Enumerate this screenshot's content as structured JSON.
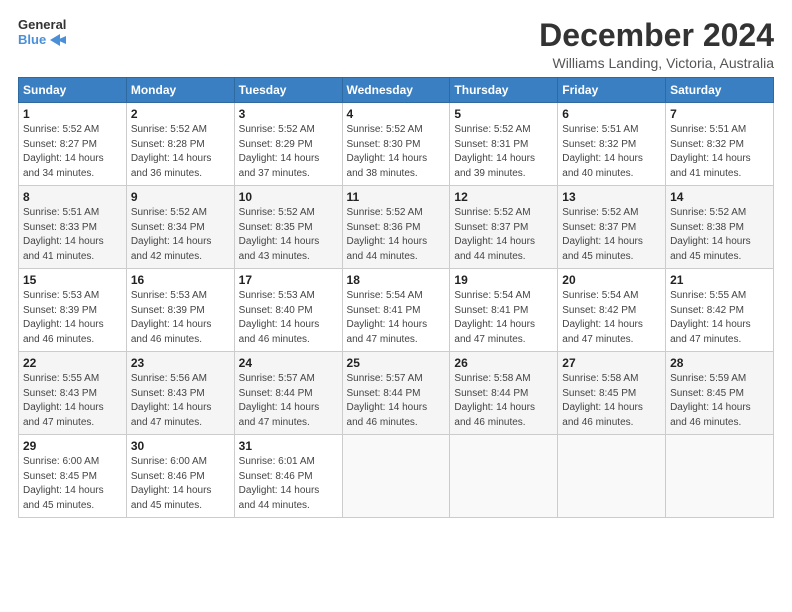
{
  "logo": {
    "general": "General",
    "blue": "Blue"
  },
  "title": "December 2024",
  "location": "Williams Landing, Victoria, Australia",
  "days_header": [
    "Sunday",
    "Monday",
    "Tuesday",
    "Wednesday",
    "Thursday",
    "Friday",
    "Saturday"
  ],
  "weeks": [
    [
      {
        "day": "1",
        "sunrise": "Sunrise: 5:52 AM",
        "sunset": "Sunset: 8:27 PM",
        "daylight": "Daylight: 14 hours and 34 minutes."
      },
      {
        "day": "2",
        "sunrise": "Sunrise: 5:52 AM",
        "sunset": "Sunset: 8:28 PM",
        "daylight": "Daylight: 14 hours and 36 minutes."
      },
      {
        "day": "3",
        "sunrise": "Sunrise: 5:52 AM",
        "sunset": "Sunset: 8:29 PM",
        "daylight": "Daylight: 14 hours and 37 minutes."
      },
      {
        "day": "4",
        "sunrise": "Sunrise: 5:52 AM",
        "sunset": "Sunset: 8:30 PM",
        "daylight": "Daylight: 14 hours and 38 minutes."
      },
      {
        "day": "5",
        "sunrise": "Sunrise: 5:52 AM",
        "sunset": "Sunset: 8:31 PM",
        "daylight": "Daylight: 14 hours and 39 minutes."
      },
      {
        "day": "6",
        "sunrise": "Sunrise: 5:51 AM",
        "sunset": "Sunset: 8:32 PM",
        "daylight": "Daylight: 14 hours and 40 minutes."
      },
      {
        "day": "7",
        "sunrise": "Sunrise: 5:51 AM",
        "sunset": "Sunset: 8:32 PM",
        "daylight": "Daylight: 14 hours and 41 minutes."
      }
    ],
    [
      {
        "day": "8",
        "sunrise": "Sunrise: 5:51 AM",
        "sunset": "Sunset: 8:33 PM",
        "daylight": "Daylight: 14 hours and 41 minutes."
      },
      {
        "day": "9",
        "sunrise": "Sunrise: 5:52 AM",
        "sunset": "Sunset: 8:34 PM",
        "daylight": "Daylight: 14 hours and 42 minutes."
      },
      {
        "day": "10",
        "sunrise": "Sunrise: 5:52 AM",
        "sunset": "Sunset: 8:35 PM",
        "daylight": "Daylight: 14 hours and 43 minutes."
      },
      {
        "day": "11",
        "sunrise": "Sunrise: 5:52 AM",
        "sunset": "Sunset: 8:36 PM",
        "daylight": "Daylight: 14 hours and 44 minutes."
      },
      {
        "day": "12",
        "sunrise": "Sunrise: 5:52 AM",
        "sunset": "Sunset: 8:37 PM",
        "daylight": "Daylight: 14 hours and 44 minutes."
      },
      {
        "day": "13",
        "sunrise": "Sunrise: 5:52 AM",
        "sunset": "Sunset: 8:37 PM",
        "daylight": "Daylight: 14 hours and 45 minutes."
      },
      {
        "day": "14",
        "sunrise": "Sunrise: 5:52 AM",
        "sunset": "Sunset: 8:38 PM",
        "daylight": "Daylight: 14 hours and 45 minutes."
      }
    ],
    [
      {
        "day": "15",
        "sunrise": "Sunrise: 5:53 AM",
        "sunset": "Sunset: 8:39 PM",
        "daylight": "Daylight: 14 hours and 46 minutes."
      },
      {
        "day": "16",
        "sunrise": "Sunrise: 5:53 AM",
        "sunset": "Sunset: 8:39 PM",
        "daylight": "Daylight: 14 hours and 46 minutes."
      },
      {
        "day": "17",
        "sunrise": "Sunrise: 5:53 AM",
        "sunset": "Sunset: 8:40 PM",
        "daylight": "Daylight: 14 hours and 46 minutes."
      },
      {
        "day": "18",
        "sunrise": "Sunrise: 5:54 AM",
        "sunset": "Sunset: 8:41 PM",
        "daylight": "Daylight: 14 hours and 47 minutes."
      },
      {
        "day": "19",
        "sunrise": "Sunrise: 5:54 AM",
        "sunset": "Sunset: 8:41 PM",
        "daylight": "Daylight: 14 hours and 47 minutes."
      },
      {
        "day": "20",
        "sunrise": "Sunrise: 5:54 AM",
        "sunset": "Sunset: 8:42 PM",
        "daylight": "Daylight: 14 hours and 47 minutes."
      },
      {
        "day": "21",
        "sunrise": "Sunrise: 5:55 AM",
        "sunset": "Sunset: 8:42 PM",
        "daylight": "Daylight: 14 hours and 47 minutes."
      }
    ],
    [
      {
        "day": "22",
        "sunrise": "Sunrise: 5:55 AM",
        "sunset": "Sunset: 8:43 PM",
        "daylight": "Daylight: 14 hours and 47 minutes."
      },
      {
        "day": "23",
        "sunrise": "Sunrise: 5:56 AM",
        "sunset": "Sunset: 8:43 PM",
        "daylight": "Daylight: 14 hours and 47 minutes."
      },
      {
        "day": "24",
        "sunrise": "Sunrise: 5:57 AM",
        "sunset": "Sunset: 8:44 PM",
        "daylight": "Daylight: 14 hours and 47 minutes."
      },
      {
        "day": "25",
        "sunrise": "Sunrise: 5:57 AM",
        "sunset": "Sunset: 8:44 PM",
        "daylight": "Daylight: 14 hours and 46 minutes."
      },
      {
        "day": "26",
        "sunrise": "Sunrise: 5:58 AM",
        "sunset": "Sunset: 8:44 PM",
        "daylight": "Daylight: 14 hours and 46 minutes."
      },
      {
        "day": "27",
        "sunrise": "Sunrise: 5:58 AM",
        "sunset": "Sunset: 8:45 PM",
        "daylight": "Daylight: 14 hours and 46 minutes."
      },
      {
        "day": "28",
        "sunrise": "Sunrise: 5:59 AM",
        "sunset": "Sunset: 8:45 PM",
        "daylight": "Daylight: 14 hours and 46 minutes."
      }
    ],
    [
      {
        "day": "29",
        "sunrise": "Sunrise: 6:00 AM",
        "sunset": "Sunset: 8:45 PM",
        "daylight": "Daylight: 14 hours and 45 minutes."
      },
      {
        "day": "30",
        "sunrise": "Sunrise: 6:00 AM",
        "sunset": "Sunset: 8:46 PM",
        "daylight": "Daylight: 14 hours and 45 minutes."
      },
      {
        "day": "31",
        "sunrise": "Sunrise: 6:01 AM",
        "sunset": "Sunset: 8:46 PM",
        "daylight": "Daylight: 14 hours and 44 minutes."
      },
      null,
      null,
      null,
      null
    ]
  ]
}
